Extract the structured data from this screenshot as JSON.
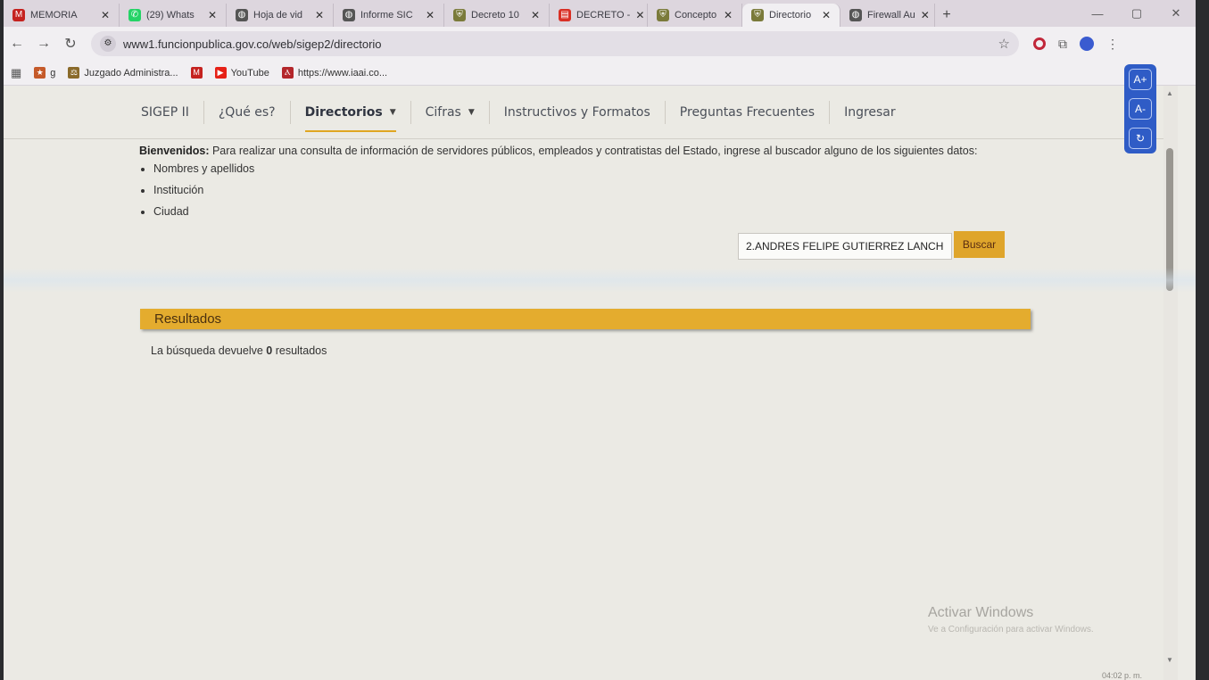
{
  "tabs": [
    {
      "label": "MEMORIA",
      "icon": "gmail-icon",
      "color": "#c5221f"
    },
    {
      "label": "(29) Whats",
      "icon": "whatsapp-icon",
      "color": "#25d366"
    },
    {
      "label": "Hoja de vid",
      "icon": "globe-icon",
      "color": "#555555"
    },
    {
      "label": "Informe SIC",
      "icon": "globe-icon",
      "color": "#555555"
    },
    {
      "label": "Decreto 10",
      "icon": "shield-icon",
      "color": "#7a7a3a"
    },
    {
      "label": "DECRETO -",
      "icon": "pdf-icon",
      "color": "#d93025"
    },
    {
      "label": "Concepto",
      "icon": "shield-icon",
      "color": "#7a7a3a"
    },
    {
      "label": "Directorio",
      "icon": "shield-icon",
      "color": "#7a7a3a",
      "active": true
    },
    {
      "label": "Firewall Au",
      "icon": "globe-icon",
      "color": "#555555"
    }
  ],
  "url": "www1.funcionpublica.gov.co/web/sigep2/directorio",
  "bookmarks": [
    {
      "label": "g",
      "icon": "bookmark-icon"
    },
    {
      "label": "Juzgado Administra...",
      "icon": "court-icon"
    },
    {
      "label": "",
      "icon": "gmail-icon"
    },
    {
      "label": "YouTube",
      "icon": "youtube-icon"
    },
    {
      "label": "https://www.iaai.co...",
      "icon": "iaai-icon"
    }
  ],
  "nav": {
    "sigep": "SIGEP II",
    "que_es": "¿Qué es?",
    "directorios": "Directorios",
    "cifras": "Cifras",
    "instructivos": "Instructivos y Formatos",
    "preguntas": "Preguntas Frecuentes",
    "ingresar": "Ingresar"
  },
  "intro": {
    "bold": "Bienvenidos:",
    "text": " Para realizar una consulta de información de servidores públicos, empleados y contratistas del Estado, ingrese al buscador alguno de los siguientes datos:",
    "items": [
      "Nombres y apellidos",
      "Institución",
      "Ciudad"
    ]
  },
  "search": {
    "value": "2.ANDRES FELIPE GUTIERREZ LANCH",
    "button": "Buscar"
  },
  "results": {
    "title": "Resultados",
    "prefix": "La búsqueda devuelve ",
    "count": "0",
    "suffix": " resultados"
  },
  "a11y": {
    "increase": "A+",
    "decrease": "A-",
    "reset": "↻"
  },
  "windows": {
    "line1": "Activar Windows",
    "line2": "Ve a Configuración para activar Windows.",
    "time": "04:02 p. m."
  },
  "colors": {
    "accent": "#e4ac2e",
    "a11y": "#2f5cc6"
  }
}
